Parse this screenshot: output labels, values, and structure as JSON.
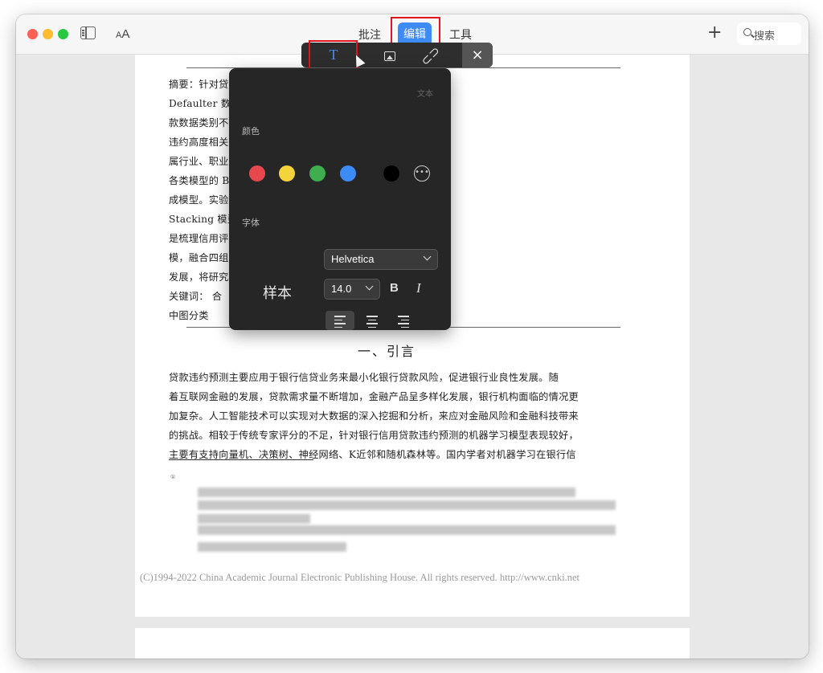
{
  "toolbar": {
    "tabs": [
      "批注",
      "编辑",
      "工具"
    ],
    "search_placeholder": "搜索",
    "text_size_small": "A",
    "text_size_large": "A",
    "plus": "+"
  },
  "format_toolbar": {
    "text_tool": "T",
    "close": "×"
  },
  "text_panel": {
    "header": "文本",
    "color_label": "颜色",
    "font_label": "字体",
    "colors": [
      "#e5484d",
      "#f5d33a",
      "#3fae4e",
      "#3d8bf5",
      "#000000"
    ],
    "font_family": "Helvetica",
    "sample": "样本",
    "font_size": "14.0",
    "bold": "B",
    "italic": "I",
    "more": "•••"
  },
  "document": {
    "abstract_lines": [
      "摘要：针对贷款违约的                                    ，本文基于 Kaggle 平台的 Loan",
      "Defaulter 数据                                                    ，以降低信贷风险。本文根据贷",
      "款数据类别不                                                    以及探索性数据分析，得出与贷款",
      "违约高度相关                                                    所在城市、住房类型、总收入、所",
      "属行业、职业                                                    、贷款金额、贷款年金等。在比较",
      "各类模型的               Boost 以及 K 近邻组合为 Stacking 集",
      "成模型。实验                                                    有更高的精确度和预测效果，其中",
      "Stacking 模型                                                     测效果。本文主要创新点有二：一",
      "是梳理信用评                                                    的优势，引入 Stacking 模型组合建",
      "模，融合四组                                                    风险评估效果；二是基于普惠金融",
      "发展，将研究                                                    出得出影响贷款违约的重要特征。",
      "    关键词：                                                        合",
      "    中图分类"
    ],
    "intro_heading": "一、引言",
    "intro_lines": [
      "    贷款违约预测主要应用于银行信贷业务来最小化银行贷款风险，促进银行业良性发展。随",
      "着互联网金融的发展，贷款需求量不断增加，金融产品呈多样化发展，银行机构面临的情况更",
      "加复杂。人工智能技术可以实现对大数据的深入挖掘和分析，来应对金融风险和金融科技带来",
      "的挑战。相较于传统专家评分的不足，针对银行信用贷款违约预测的机器学习模型表现较好，",
      "主要有支持向量机、决策树、神经网络、K近邻和随机森林等。国内学者对机器学习在银行信"
    ],
    "footnote_marker": "①",
    "copyright": "(C)1994-2022 China Academic Journal Electronic Publishing House. All rights reserved.    http://www.cnki.net"
  }
}
